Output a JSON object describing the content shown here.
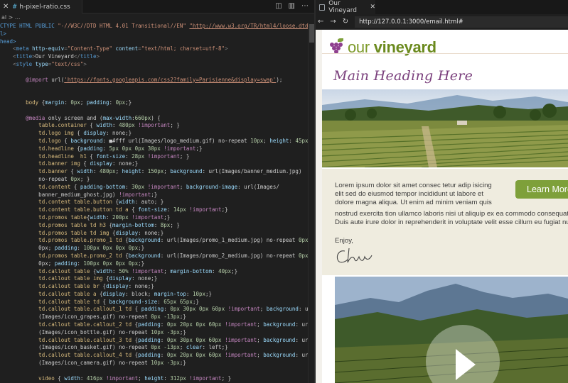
{
  "editor": {
    "tab_label": "h-pixel-ratio.css",
    "tab_icon": "css-hash-icon",
    "breadcrumb": "al > ...",
    "lines": [
      [
        [
          "k",
          "CTYPE HTML PUBLIC "
        ],
        [
          "s",
          "\"-//W3C//DTD HTML 4.01 Transitional//EN\""
        ],
        [
          "k",
          " "
        ],
        [
          "u",
          "\"http://www.w3.org/TR/html4/loose.dtd\""
        ],
        [
          "g",
          ">"
        ]
      ],
      [
        [
          "k",
          "l>"
        ]
      ],
      [
        [
          "k",
          "head>"
        ]
      ],
      [
        [
          "g",
          "    <"
        ],
        [
          "k",
          "meta"
        ],
        [
          "a",
          " http-equiv"
        ],
        [
          "g",
          "="
        ],
        [
          "s",
          "\"Content-Type\""
        ],
        [
          "a",
          " content"
        ],
        [
          "g",
          "="
        ],
        [
          "s",
          "\"text/html; charset=utf-8\""
        ],
        [
          "g",
          ">"
        ]
      ],
      [
        [
          "g",
          "    <"
        ],
        [
          "k",
          "title"
        ],
        [
          "g",
          ">"
        ],
        [
          "c",
          "Our Vineyard"
        ],
        [
          "g",
          "</"
        ],
        [
          "k",
          "title"
        ],
        [
          "g",
          ">"
        ]
      ],
      [
        [
          "g",
          "    <"
        ],
        [
          "k",
          "style"
        ],
        [
          "a",
          " type"
        ],
        [
          "g",
          "="
        ],
        [
          "s",
          "\"text/css\""
        ],
        [
          "g",
          ">"
        ]
      ],
      [
        [
          "c",
          ""
        ]
      ],
      [
        [
          "p",
          "        @import"
        ],
        [
          "c",
          " url("
        ],
        [
          "u",
          "'https://fonts.googleapis.com/css2?family=Parisienne&display=swap'"
        ],
        [
          "c",
          ");"
        ]
      ],
      [
        [
          "c",
          ""
        ]
      ],
      [
        [
          "c",
          ""
        ]
      ],
      [
        [
          "t",
          "        body"
        ],
        [
          "c",
          " {"
        ],
        [
          "a",
          "margin"
        ],
        [
          "c",
          ": "
        ],
        [
          "n",
          "0px"
        ],
        [
          "c",
          "; "
        ],
        [
          "a",
          "padding"
        ],
        [
          "c",
          ": "
        ],
        [
          "n",
          "0px"
        ],
        [
          "c",
          ";}"
        ]
      ],
      [
        [
          "c",
          ""
        ]
      ],
      [
        [
          "p",
          "        @media"
        ],
        [
          "c",
          " only screen and ("
        ],
        [
          "a",
          "max-width"
        ],
        [
          "c",
          ":"
        ],
        [
          "n",
          "660px"
        ],
        [
          "c",
          ") {"
        ]
      ],
      [
        [
          "t",
          "            table.container"
        ],
        [
          "c",
          " { "
        ],
        [
          "a",
          "width"
        ],
        [
          "c",
          ": "
        ],
        [
          "n",
          "480px"
        ],
        [
          "p",
          " !important"
        ],
        [
          "c",
          "; }"
        ]
      ],
      [
        [
          "t",
          "            td.logo img"
        ],
        [
          "c",
          " { "
        ],
        [
          "a",
          "display"
        ],
        [
          "c",
          ": none;}"
        ]
      ],
      [
        [
          "t",
          "            td.logo"
        ],
        [
          "c",
          " { "
        ],
        [
          "a",
          "background"
        ],
        [
          "c",
          ": ■#fff url(Images/logo_medium.gif) no-repeat "
        ],
        [
          "n",
          "10px"
        ],
        [
          "c",
          "; "
        ],
        [
          "a",
          "height"
        ],
        [
          "c",
          ": "
        ],
        [
          "n",
          "45px"
        ],
        [
          "c",
          "; }"
        ]
      ],
      [
        [
          "t",
          "            td.headline"
        ],
        [
          "c",
          " {"
        ],
        [
          "a",
          "padding"
        ],
        [
          "c",
          ": "
        ],
        [
          "n",
          "5px 0px 0px 30px"
        ],
        [
          "p",
          " !important"
        ],
        [
          "c",
          ";}"
        ]
      ],
      [
        [
          "t",
          "            td.headline  h1"
        ],
        [
          "c",
          " { "
        ],
        [
          "a",
          "font-size"
        ],
        [
          "c",
          ": "
        ],
        [
          "n",
          "28px"
        ],
        [
          "p",
          " !important"
        ],
        [
          "c",
          "; }"
        ]
      ],
      [
        [
          "t",
          "            td.banner img"
        ],
        [
          "c",
          " { "
        ],
        [
          "a",
          "display"
        ],
        [
          "c",
          ": none;}"
        ]
      ],
      [
        [
          "t",
          "            td.banner"
        ],
        [
          "c",
          " { "
        ],
        [
          "a",
          "width"
        ],
        [
          "c",
          ": "
        ],
        [
          "n",
          "480px"
        ],
        [
          "c",
          "; "
        ],
        [
          "a",
          "height"
        ],
        [
          "c",
          ": "
        ],
        [
          "n",
          "150px"
        ],
        [
          "c",
          "; "
        ],
        [
          "a",
          "background"
        ],
        [
          "c",
          ": url(Images/banner_medium.jpg)"
        ]
      ],
      [
        [
          "c",
          "            no-repeat "
        ],
        [
          "n",
          "0px"
        ],
        [
          "c",
          "; }"
        ]
      ],
      [
        [
          "t",
          "            td.content"
        ],
        [
          "c",
          " { "
        ],
        [
          "a",
          "padding-bottom"
        ],
        [
          "c",
          ": "
        ],
        [
          "n",
          "30px"
        ],
        [
          "p",
          " !important"
        ],
        [
          "c",
          "; "
        ],
        [
          "a",
          "background-image"
        ],
        [
          "c",
          ": url(Images/"
        ]
      ],
      [
        [
          "c",
          "            banner_medium_ghost.jpg)"
        ],
        [
          "p",
          " !important"
        ],
        [
          "c",
          ";}"
        ]
      ],
      [
        [
          "t",
          "            td.content table.button"
        ],
        [
          "c",
          " {"
        ],
        [
          "a",
          "width"
        ],
        [
          "c",
          ": auto; }"
        ]
      ],
      [
        [
          "t",
          "            td.content table.button td a"
        ],
        [
          "c",
          " { "
        ],
        [
          "a",
          "font-size"
        ],
        [
          "c",
          ": "
        ],
        [
          "n",
          "14px"
        ],
        [
          "p",
          " !important"
        ],
        [
          "c",
          ";}"
        ]
      ],
      [
        [
          "t",
          "            td.promos table"
        ],
        [
          "c",
          "{"
        ],
        [
          "a",
          "width"
        ],
        [
          "c",
          ": "
        ],
        [
          "n",
          "200px"
        ],
        [
          "p",
          " !important"
        ],
        [
          "c",
          ";}"
        ]
      ],
      [
        [
          "t",
          "            td.promos table td h3"
        ],
        [
          "c",
          " {"
        ],
        [
          "a",
          "margin-bottom"
        ],
        [
          "c",
          ": "
        ],
        [
          "n",
          "8px"
        ],
        [
          "c",
          "; }"
        ]
      ],
      [
        [
          "t",
          "            td.promos table td img"
        ],
        [
          "c",
          " {"
        ],
        [
          "a",
          "display"
        ],
        [
          "c",
          ": none;}"
        ]
      ],
      [
        [
          "t",
          "            td.promos table.promo_1 td"
        ],
        [
          "c",
          " {"
        ],
        [
          "a",
          "background"
        ],
        [
          "c",
          ": url(Images/promo_1_medium.jpg) no-repeat "
        ],
        [
          "n",
          "0px"
        ]
      ],
      [
        [
          "c",
          "            0px; "
        ],
        [
          "a",
          "padding"
        ],
        [
          "c",
          ": "
        ],
        [
          "n",
          "100px 0px 0px 0px"
        ],
        [
          "c",
          ";}"
        ]
      ],
      [
        [
          "t",
          "            td.promos table.promo_2 td"
        ],
        [
          "c",
          " {"
        ],
        [
          "a",
          "background"
        ],
        [
          "c",
          ": url(Images/promo_2_medium.jpg) no-repeat "
        ],
        [
          "n",
          "0px"
        ]
      ],
      [
        [
          "c",
          "            0px; "
        ],
        [
          "a",
          "padding"
        ],
        [
          "c",
          ": "
        ],
        [
          "n",
          "100px 0px 0px 0px"
        ],
        [
          "c",
          ";}"
        ]
      ],
      [
        [
          "t",
          "            td.callout table"
        ],
        [
          "c",
          " {"
        ],
        [
          "a",
          "width"
        ],
        [
          "c",
          ": "
        ],
        [
          "n",
          "50%"
        ],
        [
          "p",
          " !important"
        ],
        [
          "c",
          "; "
        ],
        [
          "a",
          "margin-bottom"
        ],
        [
          "c",
          ": "
        ],
        [
          "n",
          "40px"
        ],
        [
          "c",
          ";}"
        ]
      ],
      [
        [
          "t",
          "            td.callout table img"
        ],
        [
          "c",
          " {"
        ],
        [
          "a",
          "display"
        ],
        [
          "c",
          ": none;}"
        ]
      ],
      [
        [
          "t",
          "            td.callout table br"
        ],
        [
          "c",
          " {"
        ],
        [
          "a",
          "display"
        ],
        [
          "c",
          ": none;}"
        ]
      ],
      [
        [
          "t",
          "            td.callout table a"
        ],
        [
          "c",
          " {"
        ],
        [
          "a",
          "display"
        ],
        [
          "c",
          ": block; "
        ],
        [
          "a",
          "margin-top"
        ],
        [
          "c",
          ": "
        ],
        [
          "n",
          "10px"
        ],
        [
          "c",
          ";}"
        ]
      ],
      [
        [
          "t",
          "            td.callout table td"
        ],
        [
          "c",
          " { "
        ],
        [
          "a",
          "background-size"
        ],
        [
          "c",
          ": "
        ],
        [
          "n",
          "65px 65px"
        ],
        [
          "c",
          ";}"
        ]
      ],
      [
        [
          "t",
          "            td.callout table.callout_1 td"
        ],
        [
          "c",
          " { "
        ],
        [
          "a",
          "padding"
        ],
        [
          "c",
          ": "
        ],
        [
          "n",
          "0px 30px 0px 60px"
        ],
        [
          "p",
          " !important"
        ],
        [
          "c",
          "; "
        ],
        [
          "a",
          "background"
        ],
        [
          "c",
          ": url"
        ]
      ],
      [
        [
          "c",
          "            (Images/icon_grapes.gif) no-repeat "
        ],
        [
          "n",
          "0px -13px"
        ],
        [
          "c",
          ";}"
        ]
      ],
      [
        [
          "t",
          "            td.callout table.callout_2 td"
        ],
        [
          "c",
          " {"
        ],
        [
          "a",
          "padding"
        ],
        [
          "c",
          ": "
        ],
        [
          "n",
          "0px 20px 0px 60px"
        ],
        [
          "p",
          " !important"
        ],
        [
          "c",
          "; "
        ],
        [
          "a",
          "background"
        ],
        [
          "c",
          ": url"
        ]
      ],
      [
        [
          "c",
          "            (Images/icon_bottle.gif) no-repeat "
        ],
        [
          "n",
          "10px -3px"
        ],
        [
          "c",
          ";}"
        ]
      ],
      [
        [
          "t",
          "            td.callout table.callout_3 td"
        ],
        [
          "c",
          " {"
        ],
        [
          "a",
          "padding"
        ],
        [
          "c",
          ": "
        ],
        [
          "n",
          "0px 30px 0px 60px"
        ],
        [
          "p",
          " !important"
        ],
        [
          "c",
          "; "
        ],
        [
          "a",
          "background"
        ],
        [
          "c",
          ": url"
        ]
      ],
      [
        [
          "c",
          "            (Images/icon_basket.gif) no-repeat "
        ],
        [
          "n",
          "0px -13px"
        ],
        [
          "c",
          "; "
        ],
        [
          "a",
          "clear"
        ],
        [
          "c",
          ": left;}"
        ]
      ],
      [
        [
          "t",
          "            td.callout table.callout_4 td"
        ],
        [
          "c",
          " {"
        ],
        [
          "a",
          "padding"
        ],
        [
          "c",
          ": "
        ],
        [
          "n",
          "0px 20px 0px 60px"
        ],
        [
          "p",
          " !important"
        ],
        [
          "c",
          "; "
        ],
        [
          "a",
          "background"
        ],
        [
          "c",
          ": url"
        ]
      ],
      [
        [
          "c",
          "            (Images/icon_camera.gif) no-repeat "
        ],
        [
          "n",
          "10px -3px"
        ],
        [
          "c",
          ";}"
        ]
      ],
      [
        [
          "c",
          ""
        ]
      ],
      [
        [
          "t",
          "            video"
        ],
        [
          "c",
          " { "
        ],
        [
          "a",
          "width"
        ],
        [
          "c",
          ": "
        ],
        [
          "n",
          "416px"
        ],
        [
          "p",
          " !important"
        ],
        [
          "c",
          "; "
        ],
        [
          "a",
          "height"
        ],
        [
          "c",
          ": "
        ],
        [
          "n",
          "312px"
        ],
        [
          "p",
          " !important"
        ],
        [
          "c",
          "; }"
        ]
      ]
    ]
  },
  "browser": {
    "tab_title": "Our Vineyard",
    "url": "http://127.0.0.1:3000/email.html#",
    "nav_back": "←",
    "nav_forward": "→",
    "nav_reload": "↻"
  },
  "email": {
    "logo_our": "our ",
    "logo_vineyard": "vineyard",
    "heading": "Main Heading Here",
    "body_lines": [
      "Lorem ipsum dolor sit amet consec tetur adip isicing",
      "elit sed do eiusmod tempor incididunt ut labore et",
      "dolore magna aliqua. Ut enim ad minim veniam quis"
    ],
    "body_lines_wide": [
      "nostrud exercita tion ullamco laboris nisi ut aliquip ex ea commodo consequat.",
      "Duis aute irure dolor in reprehenderit in voluptate velit esse cillum eu fugiat nulla"
    ],
    "learn_more": "Learn More",
    "signoff": "Enjoy,",
    "colors": {
      "purple": "#7a3f7c",
      "green": "#7ea03a",
      "cream": "#efecdf"
    }
  }
}
